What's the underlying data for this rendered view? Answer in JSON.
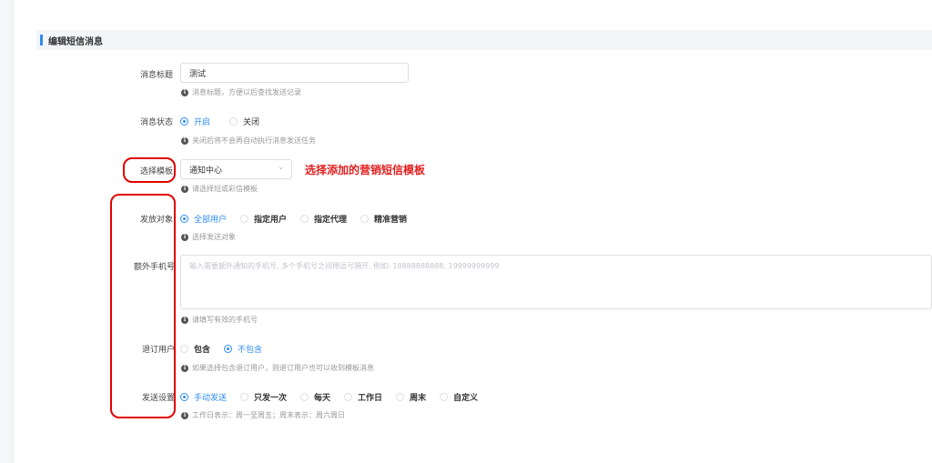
{
  "section": {
    "title": "编辑短信消息"
  },
  "fields": {
    "message_title": {
      "label": "消息标题",
      "value": "测试",
      "hint": "消息标题，方便以后查找发送记录"
    },
    "message_status": {
      "label": "消息状态",
      "options": [
        "开启",
        "关闭"
      ],
      "selected": "开启",
      "hint": "关闭后将不会再自动执行消息发送任务"
    },
    "template": {
      "label": "选择模板",
      "value": "通知中心",
      "hint": "请选择短或彩信模板"
    },
    "target": {
      "label": "发放对象",
      "options": [
        "全部用户",
        "指定用户",
        "指定代理",
        "精准营销"
      ],
      "selected": "全部用户",
      "hint": "选择发送对象"
    },
    "extra_phones": {
      "label": "额外手机号",
      "placeholder": "输入需要额外通知的手机号, 多个手机号之间用逗号隔开, 例如: 18888888888, 19999999999",
      "hint": "请填写有效的手机号"
    },
    "unsubscribed": {
      "label": "退订用户",
      "options": [
        "包含",
        "不包含"
      ],
      "selected": "不包含",
      "hint": "如果选择包含退订用户，则退订用户也可以收到模板消息"
    },
    "send_setting": {
      "label": "发送设置",
      "options": [
        "手动发送",
        "只发一次",
        "每天",
        "工作日",
        "周末",
        "自定义"
      ],
      "selected": "手动发送",
      "hint": "工作日表示：周一至周五；周末表示：周六周日"
    }
  },
  "annotation": {
    "text": "选择添加的营销短信模板",
    "color": "#e02020"
  },
  "colors": {
    "accent": "#2d8cf0",
    "annotation": "#e00000"
  },
  "icons": {
    "hint": "info-icon",
    "select": "chevron-down-icon"
  }
}
